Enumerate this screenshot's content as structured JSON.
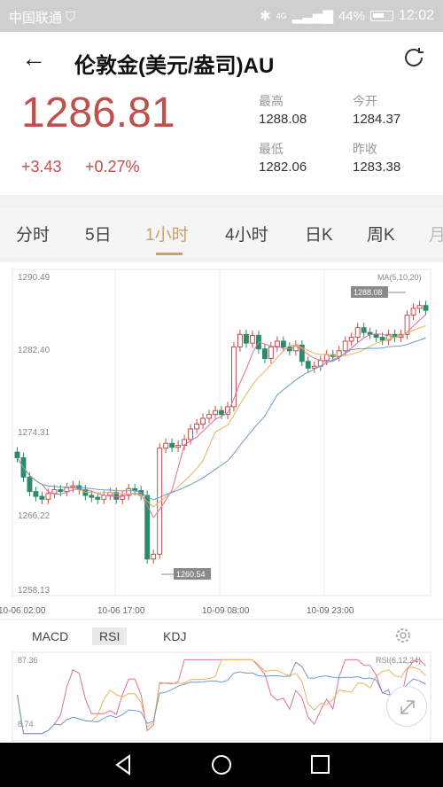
{
  "status": {
    "carrier": "中国联通",
    "network": "4G",
    "battery": "44%",
    "time": "12:02"
  },
  "header": {
    "back_icon": "arrow-left-icon",
    "title": "伦敦金(美元/盎司)AU",
    "refresh_icon": "refresh-icon"
  },
  "quote": {
    "price": "1286.81",
    "change": "+3.43",
    "change_pct": "+0.27%",
    "high_label": "最高",
    "high": "1288.08",
    "open_label": "今开",
    "open": "1284.37",
    "low_label": "最低",
    "low": "1282.06",
    "prev_label": "昨收",
    "prev": "1283.38",
    "up_color": "#c0504d"
  },
  "tabs": [
    "分时",
    "5日",
    "1小时",
    "4小时",
    "日K",
    "周K",
    "月"
  ],
  "active_tab": "1小时",
  "chart_data": {
    "type": "candlestick",
    "y_ticks": [
      "1290.49",
      "1282.40",
      "1274.31",
      "1266.22",
      "1258.13"
    ],
    "ylim": [
      1258.13,
      1290.49
    ],
    "x_labels": [
      "10-06 02:00",
      "10-06 17:00",
      "10-09 08:00",
      "10-09 23:00"
    ],
    "legend": "MA(5,10,20)",
    "max_marker": "1288.08",
    "min_marker": "1260.54",
    "closes": [
      1271.5,
      1269.5,
      1268.0,
      1267.5,
      1267.2,
      1267.8,
      1268.2,
      1268.0,
      1268.4,
      1268.6,
      1268.2,
      1267.6,
      1267.4,
      1267.2,
      1267.6,
      1267.9,
      1267.2,
      1267.6,
      1268.3,
      1268.1,
      1267.6,
      1261.0,
      1261.5,
      1272.5,
      1273.0,
      1272.6,
      1272.8,
      1273.4,
      1274.5,
      1275.0,
      1275.6,
      1276.0,
      1276.4,
      1276.0,
      1276.8,
      1283.0,
      1284.3,
      1283.4,
      1284.2,
      1282.8,
      1281.8,
      1283.0,
      1283.6,
      1283.0,
      1282.6,
      1283.2,
      1281.5,
      1280.8,
      1281.0,
      1281.6,
      1282.2,
      1282.0,
      1282.6,
      1283.6,
      1284.0,
      1285.0,
      1284.5,
      1284.3,
      1284.0,
      1283.7,
      1284.3,
      1284.0,
      1284.3,
      1286.3,
      1287.0,
      1287.3,
      1286.8
    ]
  },
  "indicators": {
    "tabs": [
      "MACD",
      "RSI",
      "KDJ"
    ],
    "active": "RSI",
    "gear_icon": "settings-gear-icon"
  },
  "rsi": {
    "top": "87.36",
    "bottom": "8.74",
    "legend": "RSI(6,12,24)",
    "expand_icon": "expand-icon"
  },
  "nav": {
    "back": "back-triangle-icon",
    "home": "home-circle-icon",
    "recent": "recent-square-icon"
  },
  "colors": {
    "up": "#c0504d",
    "down": "#2e8b6a",
    "ma5": "#e06ea0",
    "ma10": "#e8b45c",
    "ma20": "#6a9bd1",
    "accent": "#c8a06a"
  }
}
